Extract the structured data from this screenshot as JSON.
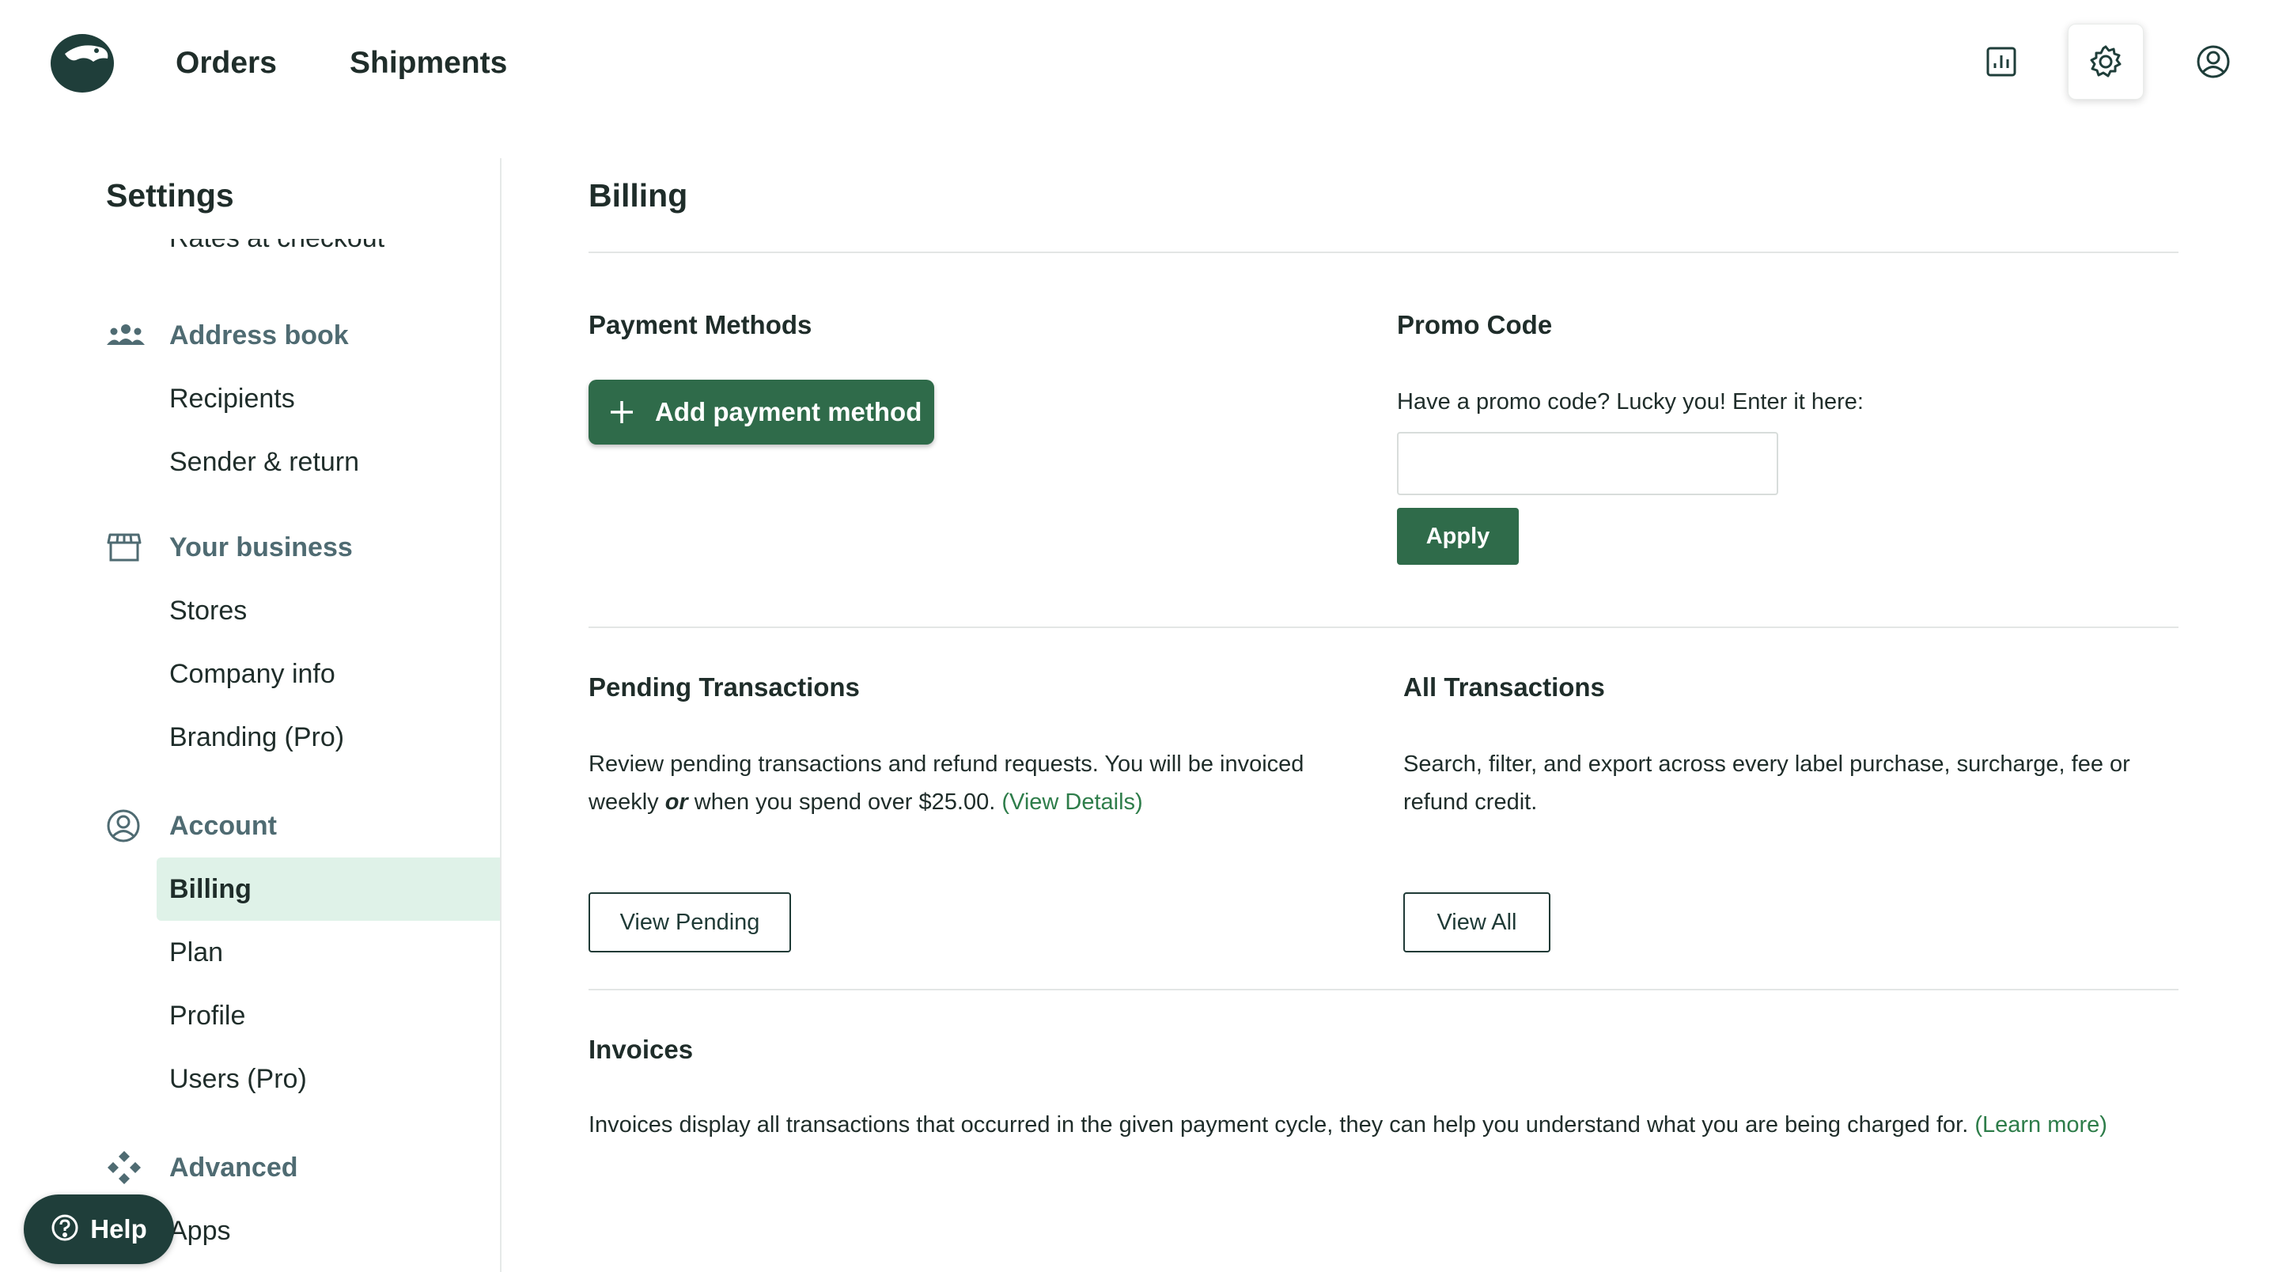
{
  "header": {
    "nav": [
      "Orders",
      "Shipments"
    ],
    "icons": [
      "reports-icon",
      "settings-icon",
      "user-profile-icon"
    ],
    "active_icon": "settings-icon"
  },
  "sidebar": {
    "title": "Settings",
    "clipped_item": "Rates at checkout",
    "groups": [
      {
        "label": "Address book",
        "icon": "people-icon",
        "items": [
          "Recipients",
          "Sender & return"
        ]
      },
      {
        "label": "Your business",
        "icon": "store-icon",
        "items": [
          "Stores",
          "Company info",
          "Branding (Pro)"
        ]
      },
      {
        "label": "Account",
        "icon": "user-circle-icon",
        "items": [
          "Billing",
          "Plan",
          "Profile",
          "Users (Pro)"
        ]
      },
      {
        "label": "Advanced",
        "icon": "diamond-arrows-icon",
        "items": [
          "Apps"
        ]
      }
    ],
    "active_item": "Billing"
  },
  "main": {
    "title": "Billing",
    "payment_methods": {
      "title": "Payment Methods",
      "button": "Add payment method"
    },
    "promo_code": {
      "title": "Promo Code",
      "prompt": "Have a promo code? Lucky you! Enter it here:",
      "value": "",
      "apply": "Apply"
    },
    "pending": {
      "title": "Pending Transactions",
      "text_1": "Review pending transactions and refund requests. You will be invoiced weekly",
      "text_or": "or",
      "text_2": " when you spend over $25.00. ",
      "link": "(View Details)",
      "button": "View Pending"
    },
    "all_transactions": {
      "title": "All Transactions",
      "text": "Search, filter, and export across every label purchase, surcharge, fee or refund credit.",
      "button": "View All"
    },
    "invoices": {
      "title": "Invoices",
      "text": "Invoices display all transactions that occurred in the given payment cycle, they can help you understand what you are being charged for. ",
      "link": "(Learn more)"
    }
  },
  "help": {
    "label": "Help"
  },
  "colors": {
    "accent": "#2f6b4a",
    "active_bg": "#dff2e8",
    "group_label": "#4f6b72",
    "link": "#2e7d4a",
    "help_bg": "#1f3e3a"
  }
}
